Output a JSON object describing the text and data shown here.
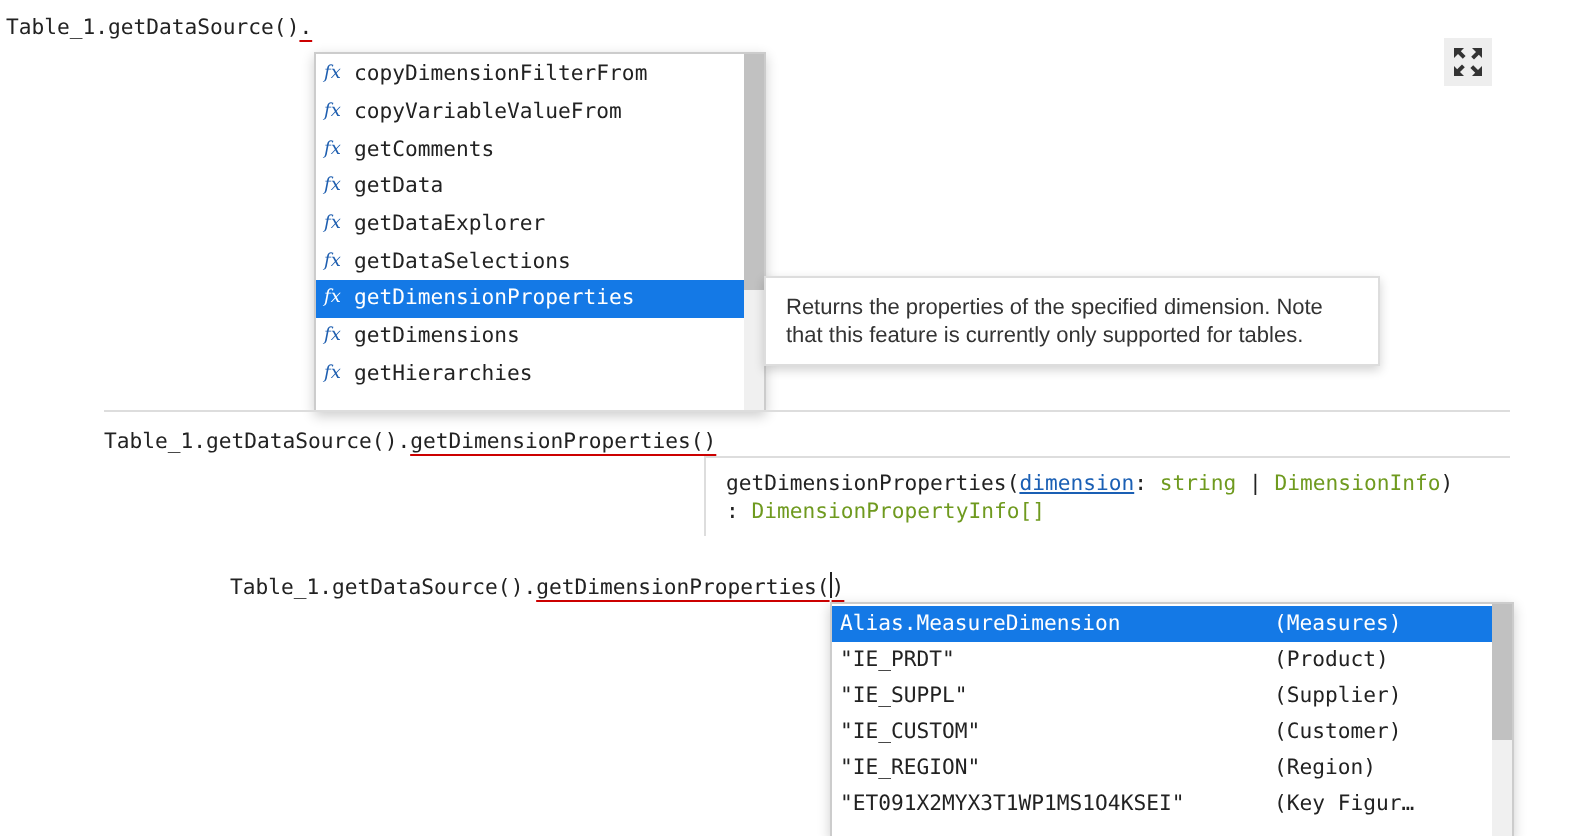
{
  "editor_1": {
    "code": [
      {
        "text": "Table_1.getDataSource()",
        "underlined": false
      },
      {
        "text": ".",
        "underlined": true
      }
    ],
    "suggestions": [
      {
        "icon": "fx",
        "label": "copyDimensionFilterFrom",
        "selected": false
      },
      {
        "icon": "fx",
        "label": "copyVariableValueFrom",
        "selected": false
      },
      {
        "icon": "fx",
        "label": "getComments",
        "selected": false
      },
      {
        "icon": "fx",
        "label": "getData",
        "selected": false
      },
      {
        "icon": "fx",
        "label": "getDataExplorer",
        "selected": false
      },
      {
        "icon": "fx",
        "label": "getDataSelections",
        "selected": false
      },
      {
        "icon": "fx",
        "label": "getDimensionProperties",
        "selected": true
      },
      {
        "icon": "fx",
        "label": "getDimensions",
        "selected": false
      },
      {
        "icon": "fx",
        "label": "getHierarchies",
        "selected": false
      }
    ],
    "tooltip": "Returns the properties of the specified dimension. Note that this feature is currently only supported for tables."
  },
  "editor_2": {
    "code": [
      {
        "text": "Table_1.getDataSource().",
        "underlined": false
      },
      {
        "text": "getDimensionProperties()",
        "underlined": true
      }
    ],
    "signature": [
      [
        {
          "kind": "plain",
          "text": "getDimensionProperties("
        },
        {
          "kind": "param",
          "text": "dimension"
        },
        {
          "kind": "plain",
          "text": ": "
        },
        {
          "kind": "type",
          "text": "string"
        },
        {
          "kind": "plain",
          "text": " | "
        },
        {
          "kind": "type",
          "text": "DimensionInfo"
        },
        {
          "kind": "plain",
          "text": ")"
        }
      ],
      [
        {
          "kind": "plain",
          "text": ": "
        },
        {
          "kind": "type",
          "text": "DimensionPropertyInfo[]"
        }
      ]
    ]
  },
  "editor_3": {
    "code": [
      {
        "kind": "text",
        "text": "Table_1.getDataSource().",
        "underlined": false
      },
      {
        "kind": "text",
        "text": "getDimensionProperties(",
        "underlined": true
      },
      {
        "kind": "caret"
      },
      {
        "kind": "text",
        "text": ")",
        "underlined": true
      }
    ],
    "suggestions": [
      {
        "label": "Alias.MeasureDimension",
        "detail": "(Measures)",
        "selected": true
      },
      {
        "label": "\"IE_PRDT\"",
        "detail": "(Product)",
        "selected": false
      },
      {
        "label": "\"IE_SUPPL\"",
        "detail": "(Supplier)",
        "selected": false
      },
      {
        "label": "\"IE_CUSTOM\"",
        "detail": "(Customer)",
        "selected": false
      },
      {
        "label": "\"IE_REGION\"",
        "detail": "(Region)",
        "selected": false
      },
      {
        "label": "\"ET091X2MYX3T1WP1MS1O4KSEI\"",
        "detail": "(Key Figur…",
        "selected": false
      }
    ]
  }
}
